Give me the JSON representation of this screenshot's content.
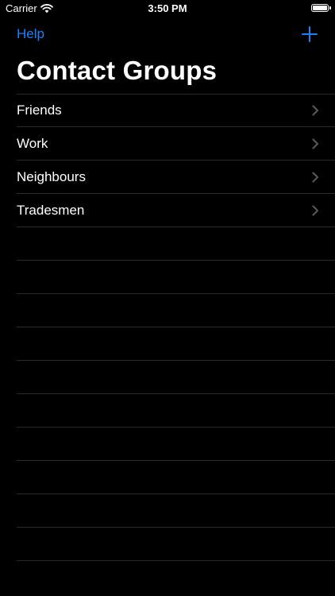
{
  "status_bar": {
    "carrier": "Carrier",
    "time": "3:50 PM"
  },
  "nav": {
    "help_label": "Help",
    "add_icon": "plus-icon",
    "title": "Contact Groups"
  },
  "groups": [
    {
      "label": "Friends"
    },
    {
      "label": "Work"
    },
    {
      "label": "Neighbours"
    },
    {
      "label": "Tradesmen"
    }
  ],
  "empty_rows": 10,
  "colors": {
    "accent": "#1a82f7",
    "background": "#000000",
    "separator": "#2a2a2c",
    "chevron": "#5a5a5e"
  }
}
